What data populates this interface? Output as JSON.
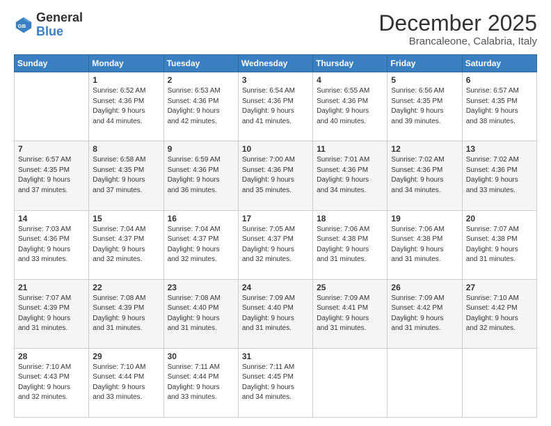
{
  "logo": {
    "text_general": "General",
    "text_blue": "Blue"
  },
  "header": {
    "month": "December 2025",
    "location": "Brancaleone, Calabria, Italy"
  },
  "weekdays": [
    "Sunday",
    "Monday",
    "Tuesday",
    "Wednesday",
    "Thursday",
    "Friday",
    "Saturday"
  ],
  "weeks": [
    [
      {
        "day": "",
        "info": ""
      },
      {
        "day": "1",
        "info": "Sunrise: 6:52 AM\nSunset: 4:36 PM\nDaylight: 9 hours\nand 44 minutes."
      },
      {
        "day": "2",
        "info": "Sunrise: 6:53 AM\nSunset: 4:36 PM\nDaylight: 9 hours\nand 42 minutes."
      },
      {
        "day": "3",
        "info": "Sunrise: 6:54 AM\nSunset: 4:36 PM\nDaylight: 9 hours\nand 41 minutes."
      },
      {
        "day": "4",
        "info": "Sunrise: 6:55 AM\nSunset: 4:36 PM\nDaylight: 9 hours\nand 40 minutes."
      },
      {
        "day": "5",
        "info": "Sunrise: 6:56 AM\nSunset: 4:35 PM\nDaylight: 9 hours\nand 39 minutes."
      },
      {
        "day": "6",
        "info": "Sunrise: 6:57 AM\nSunset: 4:35 PM\nDaylight: 9 hours\nand 38 minutes."
      }
    ],
    [
      {
        "day": "7",
        "info": "Sunrise: 6:57 AM\nSunset: 4:35 PM\nDaylight: 9 hours\nand 37 minutes."
      },
      {
        "day": "8",
        "info": "Sunrise: 6:58 AM\nSunset: 4:35 PM\nDaylight: 9 hours\nand 37 minutes."
      },
      {
        "day": "9",
        "info": "Sunrise: 6:59 AM\nSunset: 4:36 PM\nDaylight: 9 hours\nand 36 minutes."
      },
      {
        "day": "10",
        "info": "Sunrise: 7:00 AM\nSunset: 4:36 PM\nDaylight: 9 hours\nand 35 minutes."
      },
      {
        "day": "11",
        "info": "Sunrise: 7:01 AM\nSunset: 4:36 PM\nDaylight: 9 hours\nand 34 minutes."
      },
      {
        "day": "12",
        "info": "Sunrise: 7:02 AM\nSunset: 4:36 PM\nDaylight: 9 hours\nand 34 minutes."
      },
      {
        "day": "13",
        "info": "Sunrise: 7:02 AM\nSunset: 4:36 PM\nDaylight: 9 hours\nand 33 minutes."
      }
    ],
    [
      {
        "day": "14",
        "info": "Sunrise: 7:03 AM\nSunset: 4:36 PM\nDaylight: 9 hours\nand 33 minutes."
      },
      {
        "day": "15",
        "info": "Sunrise: 7:04 AM\nSunset: 4:37 PM\nDaylight: 9 hours\nand 32 minutes."
      },
      {
        "day": "16",
        "info": "Sunrise: 7:04 AM\nSunset: 4:37 PM\nDaylight: 9 hours\nand 32 minutes."
      },
      {
        "day": "17",
        "info": "Sunrise: 7:05 AM\nSunset: 4:37 PM\nDaylight: 9 hours\nand 32 minutes."
      },
      {
        "day": "18",
        "info": "Sunrise: 7:06 AM\nSunset: 4:38 PM\nDaylight: 9 hours\nand 31 minutes."
      },
      {
        "day": "19",
        "info": "Sunrise: 7:06 AM\nSunset: 4:38 PM\nDaylight: 9 hours\nand 31 minutes."
      },
      {
        "day": "20",
        "info": "Sunrise: 7:07 AM\nSunset: 4:38 PM\nDaylight: 9 hours\nand 31 minutes."
      }
    ],
    [
      {
        "day": "21",
        "info": "Sunrise: 7:07 AM\nSunset: 4:39 PM\nDaylight: 9 hours\nand 31 minutes."
      },
      {
        "day": "22",
        "info": "Sunrise: 7:08 AM\nSunset: 4:39 PM\nDaylight: 9 hours\nand 31 minutes."
      },
      {
        "day": "23",
        "info": "Sunrise: 7:08 AM\nSunset: 4:40 PM\nDaylight: 9 hours\nand 31 minutes."
      },
      {
        "day": "24",
        "info": "Sunrise: 7:09 AM\nSunset: 4:40 PM\nDaylight: 9 hours\nand 31 minutes."
      },
      {
        "day": "25",
        "info": "Sunrise: 7:09 AM\nSunset: 4:41 PM\nDaylight: 9 hours\nand 31 minutes."
      },
      {
        "day": "26",
        "info": "Sunrise: 7:09 AM\nSunset: 4:42 PM\nDaylight: 9 hours\nand 31 minutes."
      },
      {
        "day": "27",
        "info": "Sunrise: 7:10 AM\nSunset: 4:42 PM\nDaylight: 9 hours\nand 32 minutes."
      }
    ],
    [
      {
        "day": "28",
        "info": "Sunrise: 7:10 AM\nSunset: 4:43 PM\nDaylight: 9 hours\nand 32 minutes."
      },
      {
        "day": "29",
        "info": "Sunrise: 7:10 AM\nSunset: 4:44 PM\nDaylight: 9 hours\nand 33 minutes."
      },
      {
        "day": "30",
        "info": "Sunrise: 7:11 AM\nSunset: 4:44 PM\nDaylight: 9 hours\nand 33 minutes."
      },
      {
        "day": "31",
        "info": "Sunrise: 7:11 AM\nSunset: 4:45 PM\nDaylight: 9 hours\nand 34 minutes."
      },
      {
        "day": "",
        "info": ""
      },
      {
        "day": "",
        "info": ""
      },
      {
        "day": "",
        "info": ""
      }
    ]
  ]
}
